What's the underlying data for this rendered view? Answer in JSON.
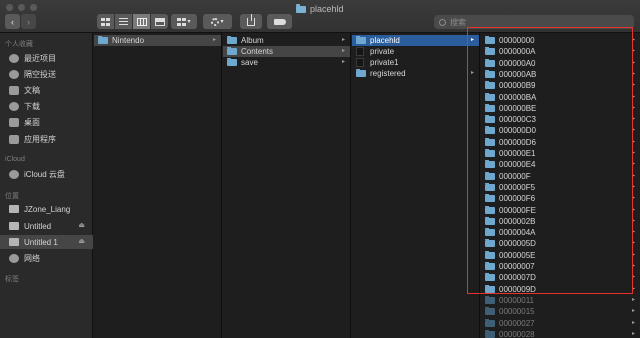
{
  "window": {
    "title": "placehld"
  },
  "search": {
    "placeholder": "搜索"
  },
  "sidebar": {
    "sections": [
      {
        "title": "个人收藏",
        "items": [
          {
            "label": "最近项目",
            "icon": "clock-icon"
          },
          {
            "label": "隔空投送",
            "icon": "airdrop-icon"
          },
          {
            "label": "文稿",
            "icon": "document-icon"
          },
          {
            "label": "下载",
            "icon": "download-icon"
          },
          {
            "label": "桌面",
            "icon": "desktop-icon"
          },
          {
            "label": "应用程序",
            "icon": "applications-icon"
          }
        ]
      },
      {
        "title": "iCloud",
        "items": [
          {
            "label": "iCloud 云盘",
            "icon": "cloud-icon"
          }
        ]
      },
      {
        "title": "位置",
        "items": [
          {
            "label": "JZone_Liang",
            "icon": "laptop-icon"
          },
          {
            "label": "Untitled",
            "icon": "disk-icon",
            "eject": "⏏"
          },
          {
            "label": "Untitled 1",
            "icon": "disk-icon",
            "eject": "⏏",
            "selected": true
          },
          {
            "label": "网络",
            "icon": "globe-icon"
          }
        ]
      },
      {
        "title": "标签",
        "items": []
      }
    ]
  },
  "columns": [
    {
      "items": [
        {
          "label": "Nintendo",
          "type": "folder",
          "state": "hl",
          "arrow": true
        }
      ]
    },
    {
      "items": [
        {
          "label": "Album",
          "type": "folder",
          "arrow": true
        },
        {
          "label": "Contents",
          "type": "folder",
          "state": "hl",
          "arrow": true
        },
        {
          "label": "save",
          "type": "folder",
          "arrow": true
        }
      ]
    },
    {
      "items": [
        {
          "label": "placehld",
          "type": "folder",
          "state": "sel",
          "arrow": true
        },
        {
          "label": "private",
          "type": "file"
        },
        {
          "label": "private1",
          "type": "file"
        },
        {
          "label": "registered",
          "type": "folder",
          "arrow": true
        }
      ]
    },
    {
      "items": [
        {
          "label": "00000000"
        },
        {
          "label": "0000000A"
        },
        {
          "label": "000000A0"
        },
        {
          "label": "000000AB"
        },
        {
          "label": "000000B9"
        },
        {
          "label": "000000BA"
        },
        {
          "label": "000000BE"
        },
        {
          "label": "000000C3"
        },
        {
          "label": "000000D0"
        },
        {
          "label": "000000D6"
        },
        {
          "label": "000000E1"
        },
        {
          "label": "000000E4"
        },
        {
          "label": "000000F"
        },
        {
          "label": "000000F5"
        },
        {
          "label": "000000F6"
        },
        {
          "label": "000000FE"
        },
        {
          "label": "0000002B"
        },
        {
          "label": "0000004A"
        },
        {
          "label": "0000005D"
        },
        {
          "label": "0000005E"
        },
        {
          "label": "00000007"
        },
        {
          "label": "0000007D"
        },
        {
          "label": "0000009D"
        },
        {
          "label": "00000011",
          "dim": true
        },
        {
          "label": "00000015",
          "dim": true
        },
        {
          "label": "00000027",
          "dim": true
        },
        {
          "label": "00000028",
          "dim": true
        }
      ]
    }
  ]
}
